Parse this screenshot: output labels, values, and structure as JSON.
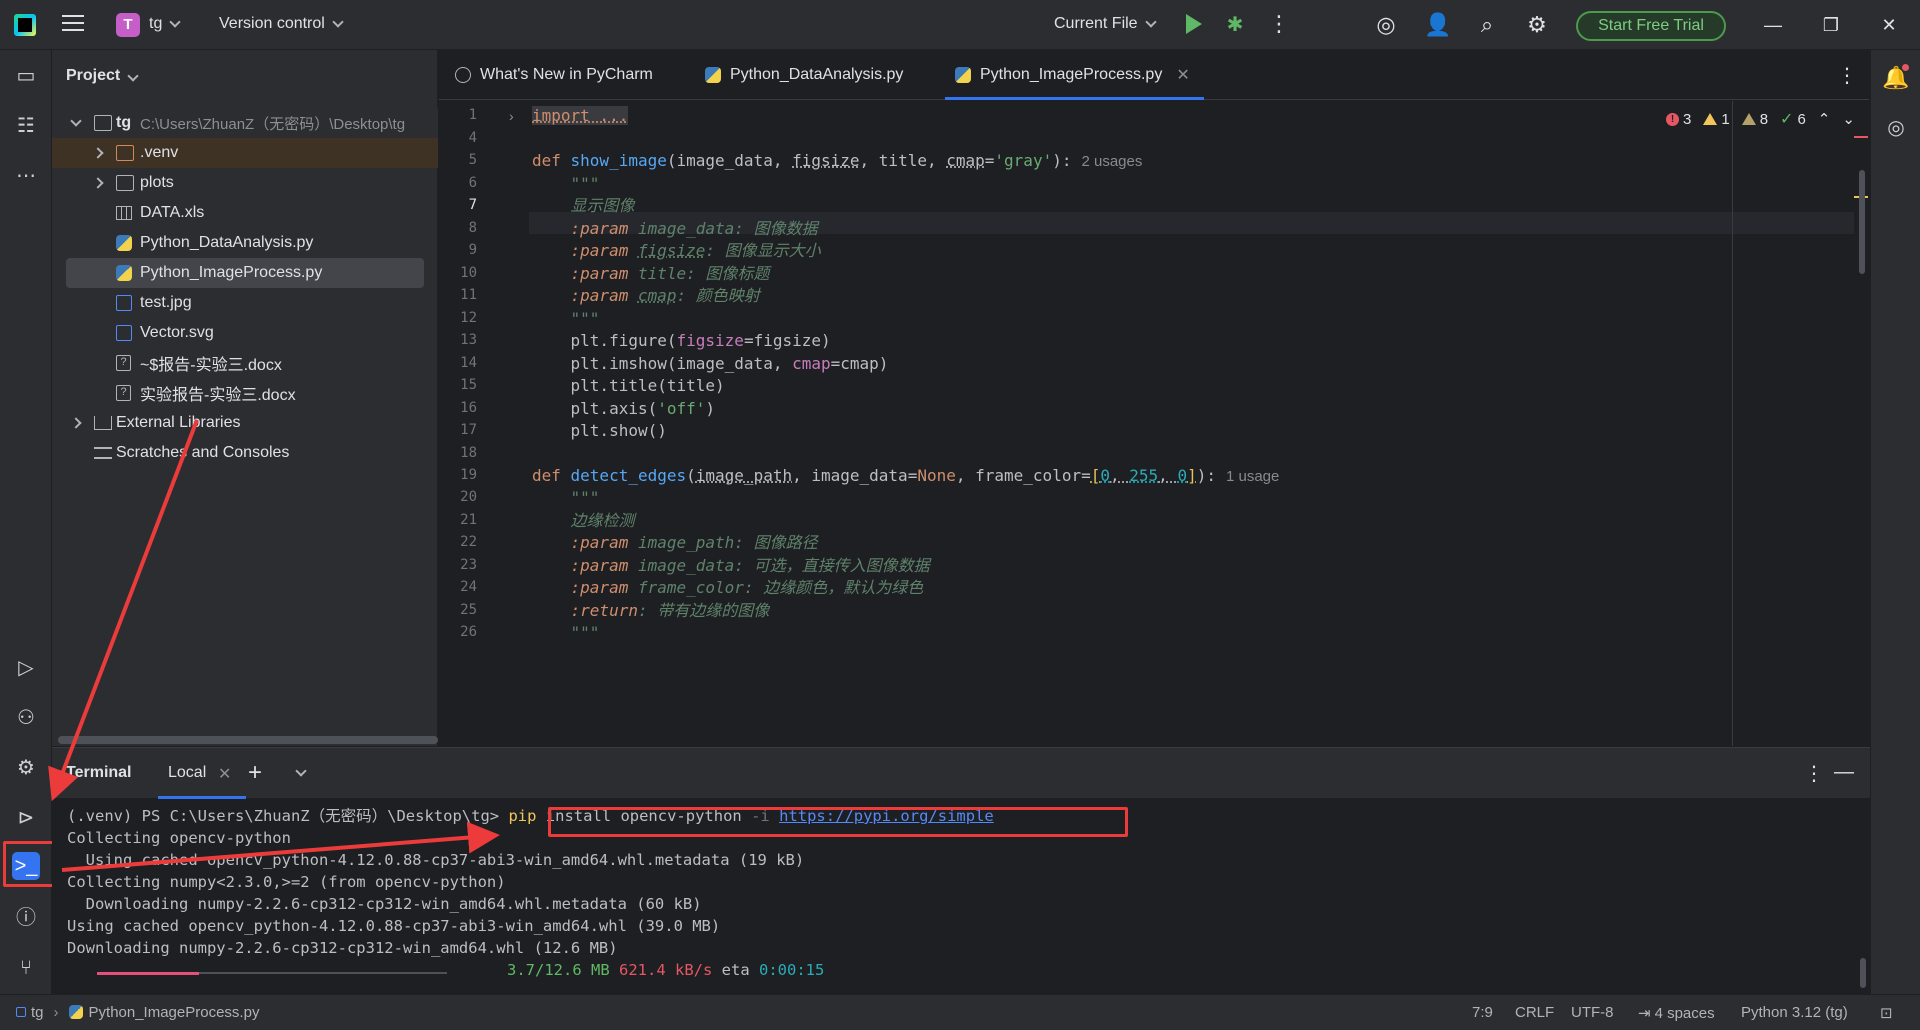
{
  "titlebar": {
    "project_badge": "T",
    "project_name": "tg",
    "version_control": "Version control",
    "run_config": "Current File",
    "trial_button": "Start Free Trial"
  },
  "project_panel": {
    "title": "Project",
    "root_name": "tg",
    "root_path": "C:\\Users\\ZhuanZ（无密码）\\Desktop\\tg",
    "items": [
      {
        "label": ".venv",
        "type": "folder-excluded"
      },
      {
        "label": "plots",
        "type": "folder"
      },
      {
        "label": "DATA.xls",
        "type": "xls"
      },
      {
        "label": "Python_DataAnalysis.py",
        "type": "python"
      },
      {
        "label": "Python_ImageProcess.py",
        "type": "python"
      },
      {
        "label": "test.jpg",
        "type": "image"
      },
      {
        "label": "Vector.svg",
        "type": "image"
      },
      {
        "label": "~$报告-实验三.docx",
        "type": "unknown"
      },
      {
        "label": "实验报告-实验三.docx",
        "type": "unknown"
      }
    ],
    "external_libraries": "External Libraries",
    "scratches": "Scratches and Consoles"
  },
  "tabs": [
    {
      "label": "What's New in PyCharm",
      "icon": "globe-icon"
    },
    {
      "label": "Python_DataAnalysis.py",
      "icon": "python-icon"
    },
    {
      "label": "Python_ImageProcess.py",
      "icon": "python-icon",
      "active": true
    }
  ],
  "inspections": {
    "errors": "3",
    "warnings": "1",
    "weak_warnings": "8",
    "ok": "6"
  },
  "editor": {
    "line_numbers": [
      "1",
      "4",
      "5",
      "6",
      "7",
      "8",
      "9",
      "10",
      "11",
      "12",
      "13",
      "14",
      "15",
      "16",
      "17",
      "18",
      "19",
      "20",
      "21",
      "22",
      "23",
      "24",
      "25",
      "26"
    ],
    "current_line": "7",
    "l1": "import ...",
    "l5_def": "def ",
    "l5_fn": "show_image",
    "l5_a": "(image_data, ",
    "l5_b": "figsize",
    "l5_c": ", title, ",
    "l5_d": "cmap",
    "l5_e": "=",
    "l5_f": "'gray'",
    "l5_g": "):",
    "l5_hint": "2 usages",
    "l6": "    \"\"\"",
    "l7": "    显示图像",
    "l8_p": "    :param ",
    "l8_v": "image_data",
    "l8_d": ": 图像数据",
    "l9_p": "    :param ",
    "l9_v": "figsize",
    "l9_d": ": 图像显示大小",
    "l10_p": "    :param ",
    "l10_v": "title",
    "l10_d": ": 图像标题",
    "l11_p": "    :param ",
    "l11_v": "cmap",
    "l11_d": ": 颜色映射",
    "l12": "    \"\"\"",
    "l13_a": "    plt.figure(",
    "l13_b": "figsize",
    "l13_c": "=figsize)",
    "l14_a": "    plt.imshow(image_data, ",
    "l14_b": "cmap",
    "l14_c": "=cmap)",
    "l15": "    plt.title(title)",
    "l16_a": "    plt.axis(",
    "l16_b": "'off'",
    "l16_c": ")",
    "l17": "    plt.show()",
    "l19_def": "def ",
    "l19_fn": "detect_edges",
    "l19_a": "(",
    "l19_b": "image_path",
    "l19_c": ", image_data=",
    "l19_d": "None",
    "l19_e": ", frame_color=",
    "l19_f": "[",
    "l19_g": "0",
    "l19_h": ", ",
    "l19_i": "255",
    "l19_j": ", ",
    "l19_k": "0",
    "l19_l": "]",
    "l19_m": "):",
    "l19_hint": "1 usage",
    "l20": "    \"\"\"",
    "l21": "    边缘检测",
    "l22_p": "    :param ",
    "l22_v": "image_path",
    "l22_d": ": 图像路径",
    "l23_p": "    :param ",
    "l23_v": "image_data",
    "l23_d": ": 可选，直接传入图像数据",
    "l24_p": "    :param ",
    "l24_v": "frame_color",
    "l24_d": ": 边缘颜色，默认为绿色",
    "l25_p": "    :return",
    "l25_d": ": 带有边缘的图像",
    "l26": "    \"\"\""
  },
  "terminal": {
    "title": "Terminal",
    "tab": "Local",
    "prompt": "(.venv) PS C:\\Users\\ZhuanZ（无密码）\\Desktop\\tg> ",
    "cmd_pip": "pip",
    "cmd_rest": " install opencv-python ",
    "cmd_flag": "-i",
    "cmd_url": "https://pypi.org/simple",
    "lines": [
      "Collecting opencv-python",
      "  Using cached opencv_python-4.12.0.88-cp37-abi3-win_amd64.whl.metadata (19 kB)",
      "Collecting numpy<2.3.0,>=2 (from opencv-python)",
      "  Downloading numpy-2.2.6-cp312-cp312-win_amd64.whl.metadata (60 kB)",
      "Using cached opencv_python-4.12.0.88-cp37-abi3-win_amd64.whl (39.0 MB)",
      "Downloading numpy-2.2.6-cp312-cp312-win_amd64.whl (12.6 MB)"
    ],
    "progress_fraction": 0.29,
    "progress_size": "3.7/12.6 MB",
    "progress_speed": "621.4 kB/s",
    "progress_eta_label": "eta",
    "progress_eta": "0:00:15"
  },
  "statusbar": {
    "project": "tg",
    "file": "Python_ImageProcess.py",
    "position": "7:9",
    "line_sep": "CRLF",
    "encoding": "UTF-8",
    "indent": "4 spaces",
    "interpreter": "Python 3.12 (tg)"
  },
  "colors": {
    "accent": "#3574f0",
    "annotation": "#ec3b3b",
    "success": "#5fb865"
  }
}
